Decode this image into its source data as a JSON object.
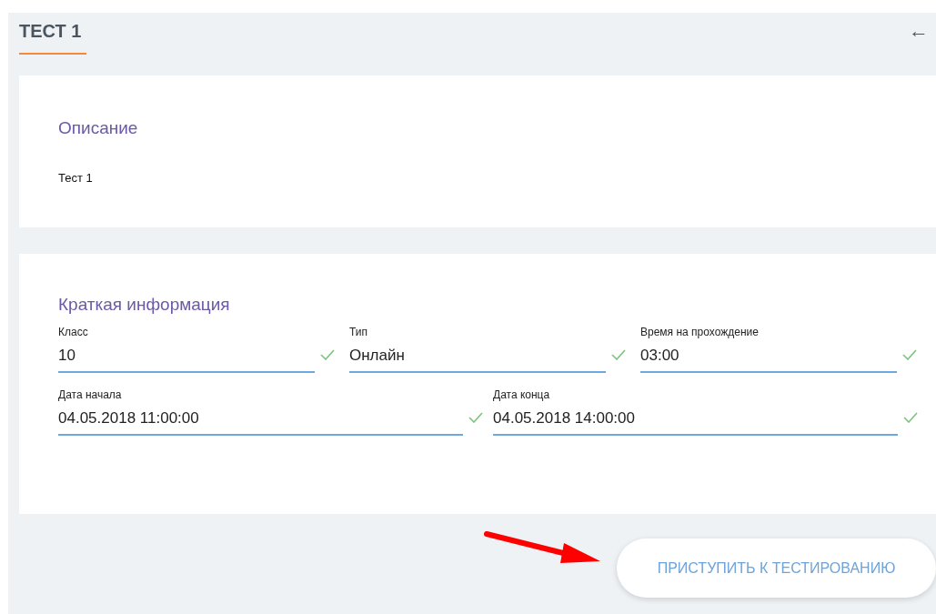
{
  "header": {
    "title": "ТЕСТ 1",
    "back_arrow": "←"
  },
  "description": {
    "heading": "Описание",
    "text": "Тест 1"
  },
  "info": {
    "heading": "Краткая информация",
    "rows": [
      [
        {
          "label": "Класс",
          "value": "10",
          "valid": true
        },
        {
          "label": "Тип",
          "value": "Онлайн",
          "valid": true
        },
        {
          "label": "Время на прохождение",
          "value": "03:00",
          "valid": true
        }
      ],
      [
        {
          "label": "Дата начала",
          "value": "04.05.2018 11:00:00",
          "valid": true
        },
        {
          "label": "Дата конца",
          "value": "04.05.2018 14:00:00",
          "valid": true
        }
      ]
    ]
  },
  "start_button": "ПРИСТУПИТЬ К ТЕСТИРОВАНИЮ"
}
